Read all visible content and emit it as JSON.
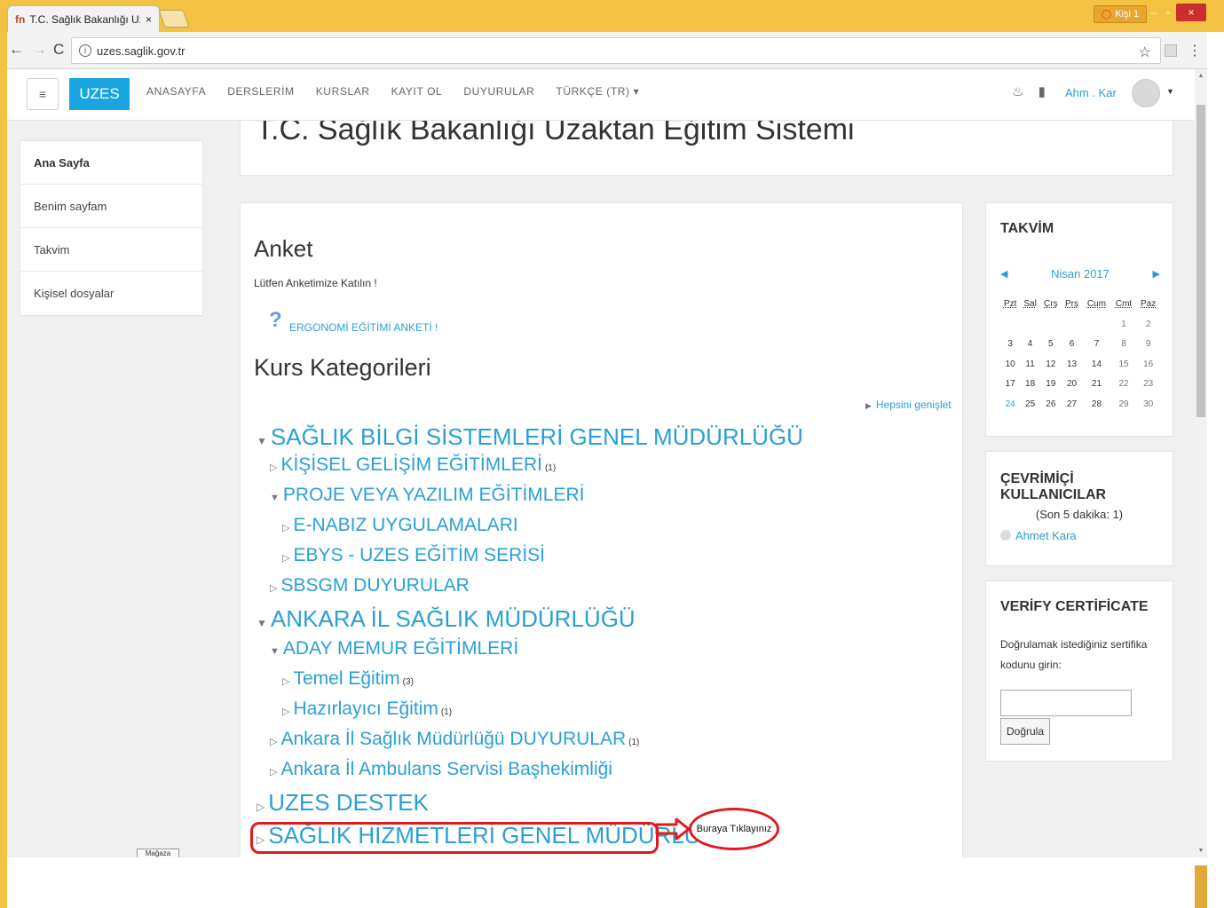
{
  "browser": {
    "tab_title": "T.C. Sağlık Bakanlığı Uza",
    "tab_close": "×",
    "profile_label": "Kişi 1",
    "url": "uzes.saglik.gov.tr"
  },
  "site": {
    "brand": "UZES",
    "nav": [
      "ANASAYFA",
      "DERSLERİM",
      "KURSLAR",
      "KAYIT OL",
      "DUYURULAR",
      "TÜRKÇE (TR) ▾"
    ],
    "username": "Ahm . Kar"
  },
  "sidebar": {
    "items": [
      {
        "label": "Ana Sayfa"
      },
      {
        "label": "Benim sayfam"
      },
      {
        "label": "Takvim"
      },
      {
        "label": "Kişisel dosyalar"
      }
    ],
    "dock_label": "Maĝaza"
  },
  "page": {
    "title": "T.C. Sağlık Bakanlığı Uzaktan Eğitim Sistemi"
  },
  "main": {
    "anket_heading": "Anket",
    "anket_sub": "Lütfen Anketimize Katılın !",
    "anket_link": "ERGONOMİ EĞİTİMİ ANKETİ !",
    "kurs_heading": "Kurs Kategorileri",
    "expand_all": "Hepsini genişlet",
    "categories": [
      {
        "label": "SAĞLIK BİLGİ SİSTEMLERİ GENEL MÜDÜRLÜĞÜ",
        "level": 1,
        "expanded": true,
        "count": ""
      },
      {
        "label": "KİŞİSEL GELİŞİM EĞİTİMLERİ",
        "level": 2,
        "expanded": false,
        "count": "(1)"
      },
      {
        "label": "PROJE VEYA YAZILIM EĞİTİMLERİ",
        "level": 2,
        "expanded": true,
        "count": ""
      },
      {
        "label": "E-NABIZ UYGULAMALARI",
        "level": 3,
        "expanded": false,
        "count": ""
      },
      {
        "label": "EBYS - UZES EĞİTİM SERİSİ",
        "level": 3,
        "expanded": false,
        "count": ""
      },
      {
        "label": "SBSGM DUYURULAR",
        "level": 2,
        "expanded": false,
        "count": ""
      },
      {
        "label": "ANKARA İL SAĞLIK MÜDÜRLÜĞÜ",
        "level": 1,
        "expanded": true,
        "count": ""
      },
      {
        "label": "ADAY MEMUR EĞİTİMLERİ",
        "level": 2,
        "expanded": true,
        "count": ""
      },
      {
        "label": "Temel Eğitim",
        "level": 3,
        "expanded": false,
        "count": "(3)"
      },
      {
        "label": "Hazırlayıcı Eğitim",
        "level": 3,
        "expanded": false,
        "count": "(1)"
      },
      {
        "label": "Ankara İl Sağlık Müdürlüğü DUYURULAR",
        "level": 2,
        "expanded": false,
        "count": "(1)"
      },
      {
        "label": "Ankara İl Ambulans Servisi Başhekimliği",
        "level": 2,
        "expanded": false,
        "count": ""
      },
      {
        "label": "UZES DESTEK",
        "level": 1,
        "expanded": false,
        "count": ""
      },
      {
        "label": "SAĞLIK HİZMETLERİ GENEL MÜDÜRLÜĞÜ",
        "level": 1,
        "expanded": false,
        "count": "(1"
      }
    ]
  },
  "calendar": {
    "heading": "TAKVİM",
    "month": "Nisan 2017",
    "weekdays": [
      "Pzt",
      "Sal",
      "Çrş",
      "Prş",
      "Cum",
      "Cmt",
      "Paz"
    ],
    "weeks": [
      [
        "",
        "",
        "",
        "",
        "",
        "1",
        "2"
      ],
      [
        "3",
        "4",
        "5",
        "6",
        "7",
        "8",
        "9"
      ],
      [
        "10",
        "11",
        "12",
        "13",
        "14",
        "15",
        "16"
      ],
      [
        "17",
        "18",
        "19",
        "20",
        "21",
        "22",
        "23"
      ],
      [
        "24",
        "25",
        "26",
        "27",
        "28",
        "29",
        "30"
      ]
    ],
    "today": "24"
  },
  "online": {
    "heading": "ÇEVRİMİÇİ KULLANICILAR",
    "sub": "(Son 5 dakika: 1)",
    "user": "Ahmet Kara"
  },
  "verify": {
    "heading": "VERİFY CERTİFİCATE",
    "desc": "Doğrulamak istediğiniz sertifika kodunu girin:",
    "button": "Doğrula"
  },
  "annotation": {
    "label": "Buraya Tıklayınız",
    "color": "#e0191f"
  },
  "colors": {
    "accent": "#2a9fd6",
    "brand": "#1aa4e0"
  }
}
